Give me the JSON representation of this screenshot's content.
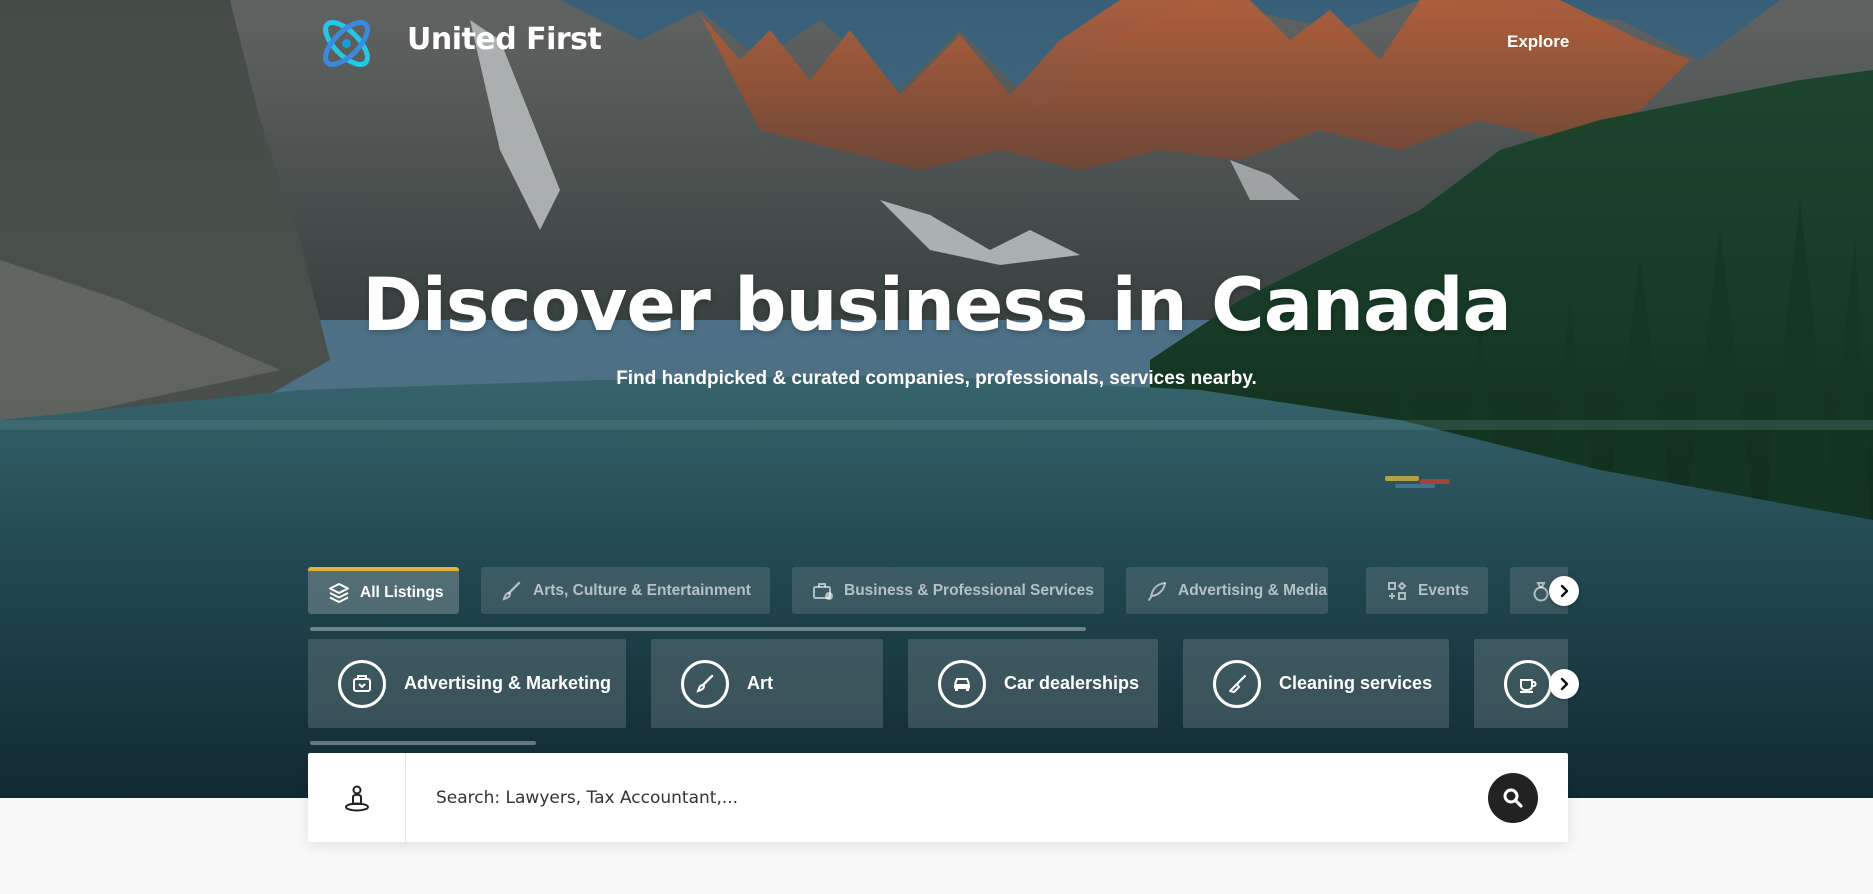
{
  "header": {
    "brand": "United First",
    "nav_explore": "Explore"
  },
  "hero": {
    "headline": "Discover business in Canada",
    "subheadline": "Find handpicked & curated companies, professionals, services nearby."
  },
  "tabs": [
    {
      "label": "All Listings",
      "icon": "layers-icon",
      "active": true
    },
    {
      "label": "Arts, Culture & Entertainment",
      "icon": "brush-icon",
      "active": false
    },
    {
      "label": "Business & Professional Services",
      "icon": "briefcase-icon",
      "active": false
    },
    {
      "label": "Advertising & Media",
      "icon": "feather-icon",
      "active": false
    },
    {
      "label": "Events",
      "icon": "events-icon",
      "active": false
    },
    {
      "label": "",
      "icon": "money-bag-icon",
      "active": false
    }
  ],
  "categories": [
    {
      "label": "Advertising & Marketing",
      "icon": "marketing-icon"
    },
    {
      "label": "Art",
      "icon": "paint-brush-icon"
    },
    {
      "label": "Car dealerships",
      "icon": "car-icon"
    },
    {
      "label": "Cleaning services",
      "icon": "broom-icon"
    },
    {
      "label": "",
      "icon": "coffee-icon"
    }
  ],
  "search": {
    "placeholder": "Search: Lawyers, Tax Accountant,...",
    "value": ""
  },
  "colors": {
    "accent": "#e2b33a",
    "logo": "#22c8e6",
    "search_button": "#222222"
  }
}
